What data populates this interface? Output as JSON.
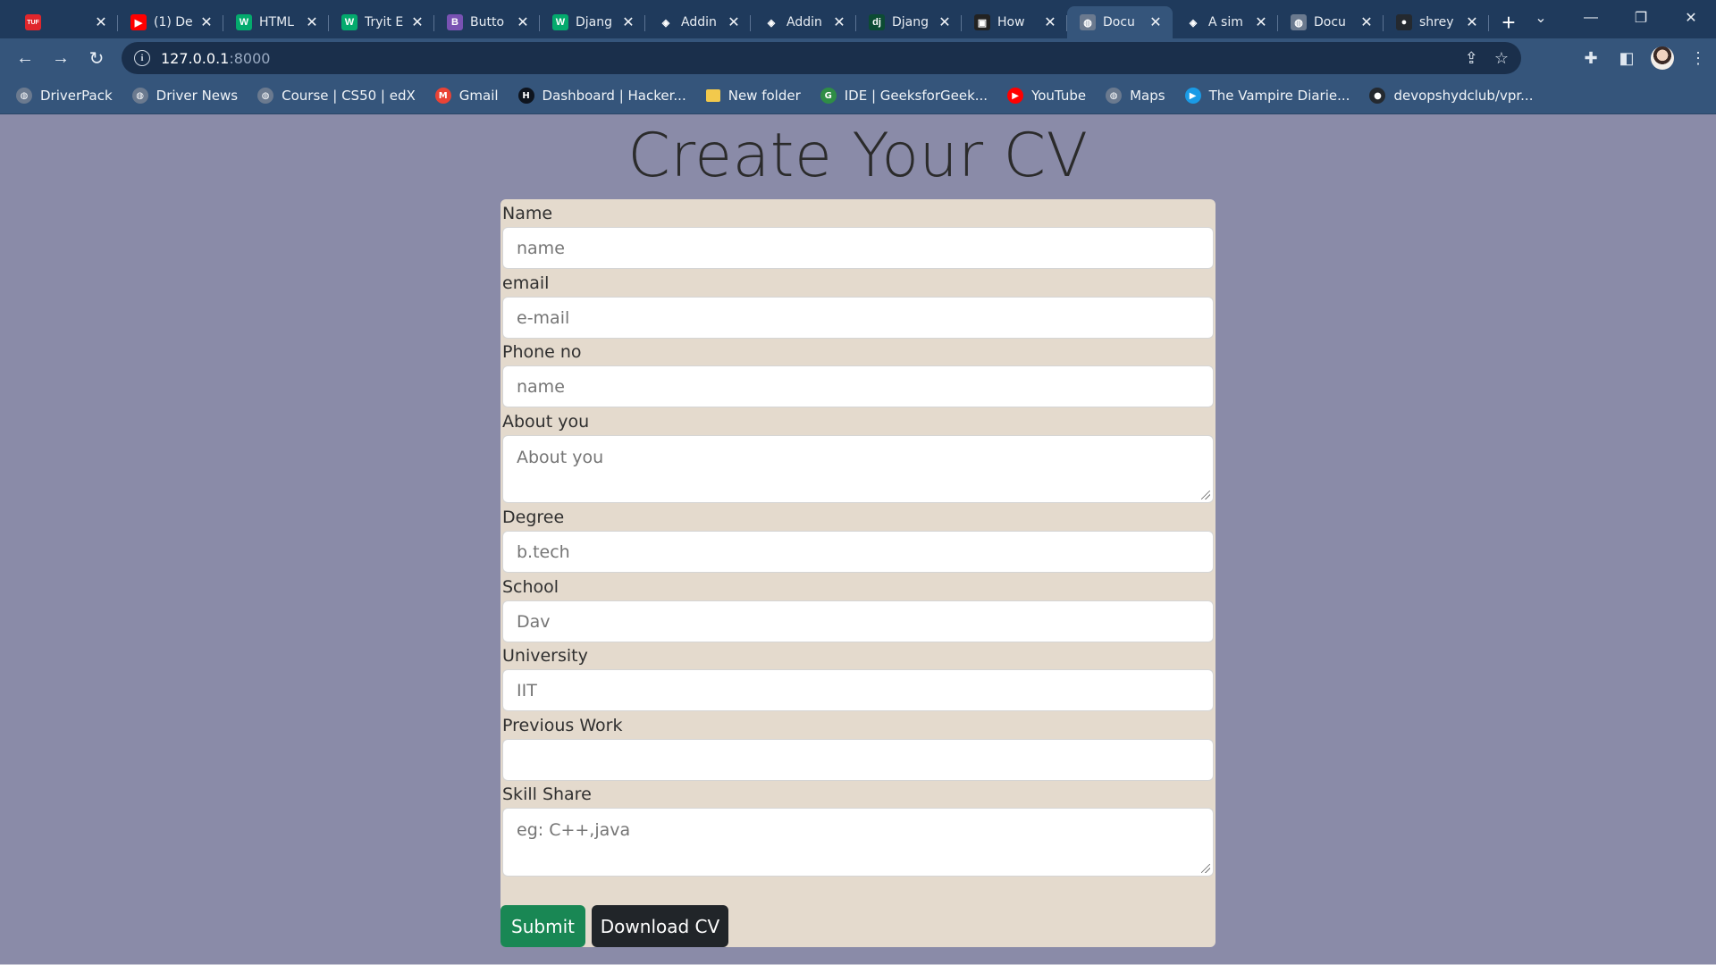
{
  "browser": {
    "tabs": [
      {
        "title": "",
        "favicon": "tuf-icon",
        "color": "#e0262c",
        "glyph": "TUF"
      },
      {
        "title": "(1) De",
        "favicon": "youtube-icon",
        "color": "#ff0000",
        "glyph": "▶"
      },
      {
        "title": "HTML",
        "favicon": "w3schools-icon",
        "color": "#04aa6d",
        "glyph": "W"
      },
      {
        "title": "Tryit E",
        "favicon": "w3schools-icon",
        "color": "#04aa6d",
        "glyph": "W"
      },
      {
        "title": "Butto",
        "favicon": "bootstrap-icon",
        "color": "#7952b3",
        "glyph": "B"
      },
      {
        "title": "Djang",
        "favicon": "w3schools-icon",
        "color": "#04aa6d",
        "glyph": "W"
      },
      {
        "title": "Addin",
        "favicon": "codepen-icon",
        "color": "#1f3a5c",
        "glyph": "◈"
      },
      {
        "title": "Addin",
        "favicon": "codepen-icon",
        "color": "#1f3a5c",
        "glyph": "◈"
      },
      {
        "title": "Djang",
        "favicon": "django-icon",
        "color": "#0c4b33",
        "glyph": "dj"
      },
      {
        "title": "How",
        "favicon": "terminal-icon",
        "color": "#222222",
        "glyph": "▣"
      },
      {
        "title": "Docu",
        "favicon": "globe-icon",
        "color": "#6b7a8f",
        "glyph": "◍"
      },
      {
        "title": "A sim",
        "favicon": "codepen-icon",
        "color": "#1f3a5c",
        "glyph": "◈"
      },
      {
        "title": "Docu",
        "favicon": "globe-icon",
        "color": "#6b7a8f",
        "glyph": "◍"
      },
      {
        "title": "shrey",
        "favicon": "github-icon",
        "color": "#24292f",
        "glyph": "●"
      }
    ],
    "active_tab": 10,
    "url_host": "127.0.0.1",
    "url_port": ":8000",
    "bookmarks": [
      {
        "label": "DriverPack",
        "favicon": "globe-icon",
        "color": "#6b7a8f",
        "glyph": "◍"
      },
      {
        "label": "Driver News",
        "favicon": "globe-icon",
        "color": "#6b7a8f",
        "glyph": "◍"
      },
      {
        "label": "Course | CS50 | edX",
        "favicon": "globe-icon",
        "color": "#6b7a8f",
        "glyph": "◍"
      },
      {
        "label": "Gmail",
        "favicon": "gmail-icon",
        "color": "#ea4335",
        "glyph": "M"
      },
      {
        "label": "Dashboard | Hacker...",
        "favicon": "hackerrank-icon",
        "color": "#0e141e",
        "glyph": "H"
      },
      {
        "label": "New folder",
        "favicon": "folder-icon",
        "color": "#f2c94c",
        "glyph": ""
      },
      {
        "label": "IDE | GeeksforGeek...",
        "favicon": "gfg-icon",
        "color": "#2f8d46",
        "glyph": "G"
      },
      {
        "label": "YouTube",
        "favicon": "youtube-icon",
        "color": "#ff0000",
        "glyph": "▶"
      },
      {
        "label": "Maps",
        "favicon": "globe-icon",
        "color": "#6b7a8f",
        "glyph": "◍"
      },
      {
        "label": "The Vampire Diarie...",
        "favicon": "play-circle-icon",
        "color": "#1a9be6",
        "glyph": "▶"
      },
      {
        "label": "devopshydclub/vpr...",
        "favicon": "github-icon",
        "color": "#24292f",
        "glyph": "●"
      }
    ]
  },
  "page": {
    "title": "Create Your CV",
    "fields": {
      "name": {
        "label": "Name",
        "placeholder": "name"
      },
      "email": {
        "label": "email",
        "placeholder": "e-mail"
      },
      "phone": {
        "label": "Phone no",
        "placeholder": "name"
      },
      "about": {
        "label": "About you",
        "placeholder": "About you"
      },
      "degree": {
        "label": "Degree",
        "placeholder": "b.tech"
      },
      "school": {
        "label": "School",
        "placeholder": "Dav"
      },
      "university": {
        "label": "University",
        "placeholder": "IIT"
      },
      "previous_work": {
        "label": "Previous Work",
        "placeholder": ""
      },
      "skills": {
        "label": "Skill Share",
        "placeholder": "eg: C++,java"
      }
    },
    "submit_label": "Submit",
    "download_label": "Download CV"
  },
  "colors": {
    "background": "#8a8ba8",
    "form_background": "#e4dacd",
    "submit": "#198754",
    "download": "#212529"
  }
}
